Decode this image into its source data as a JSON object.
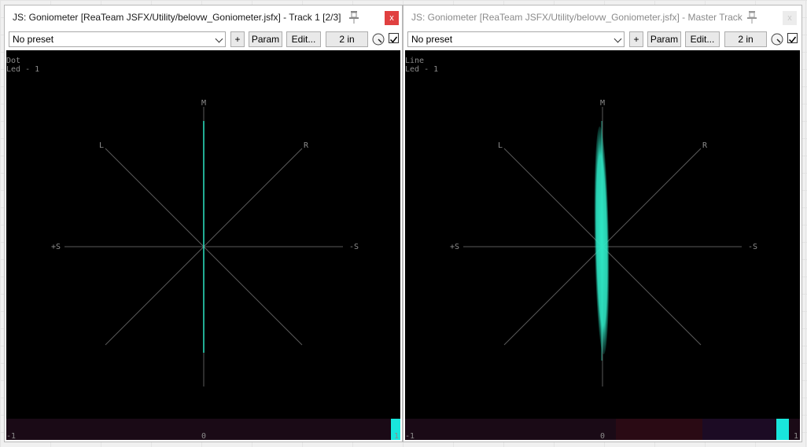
{
  "windows": [
    {
      "title": "JS: Goniometer [ReaTeam JSFX/Utility/belovw_Goniometer.jsfx] - Track 1 [2/3]",
      "active": true,
      "close_label": "x",
      "preset": "No preset",
      "add_label": "+",
      "param_label": "Param",
      "edit_label": "Edit...",
      "io_label": "2 in",
      "enabled": true,
      "mode_label": "Dot",
      "led_label": "Led - 1",
      "axis": {
        "m": "M",
        "l": "L",
        "r": "R",
        "plus_s": "+S",
        "minus_s": "-S"
      },
      "correlation": {
        "min": "-1",
        "mid": "0",
        "max": "1",
        "value": 1.0
      },
      "signal": "mono"
    },
    {
      "title": "JS: Goniometer [ReaTeam JSFX/Utility/belovw_Goniometer.jsfx] - Master Track",
      "active": false,
      "close_label": "x",
      "preset": "No preset",
      "add_label": "+",
      "param_label": "Param",
      "edit_label": "Edit...",
      "io_label": "2 in",
      "enabled": true,
      "mode_label": "Line",
      "led_label": "Led - 1",
      "axis": {
        "m": "M",
        "l": "L",
        "r": "R",
        "plus_s": "+S",
        "minus_s": "-S"
      },
      "correlation": {
        "min": "-1",
        "mid": "0",
        "max": "1",
        "value": 0.97
      },
      "signal": "near-mono"
    }
  ],
  "colors": {
    "trace": "#2ee6c4",
    "grid": "#5a5a5a",
    "label": "#8c8c8c",
    "meter_bg": "#1a0a16",
    "meter_mark": "#19e6dc"
  }
}
